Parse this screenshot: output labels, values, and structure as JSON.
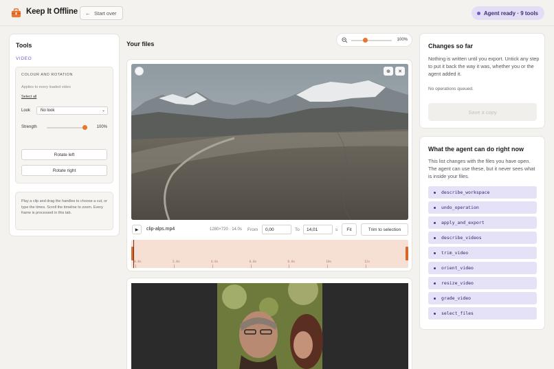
{
  "header": {
    "app_title": "Keep It Offline",
    "start_over_label": "Start over",
    "agent_status": "Agent ready · 9 tools",
    "accent_color": "#6a5ccf",
    "logo_icon": "briefcase-icon"
  },
  "tools_panel": {
    "title": "Tools",
    "active_tab": "VIDEO",
    "colour_section": {
      "title": "COLOUR AND ROTATION",
      "applies_text": "Applies to every loaded video",
      "select_all_label": "Select all",
      "look_label": "Look",
      "look_value": "No look",
      "strength_label": "Strength",
      "strength_value": "100%",
      "strength_level": 1.0,
      "rotate_left_label": "Rotate left",
      "rotate_right_label": "Rotate right"
    },
    "help_text": "Play a clip and drag the handles to choose a cut, or type the times. Scroll the timeline to zoom. Every frame is processed in this tab."
  },
  "files": {
    "title": "Your files",
    "zoom_value": "100%",
    "zoom_level": 0.35,
    "clip": {
      "name": "clip-alps.mp4",
      "meta": "1280×720 · 14.0s",
      "from_label": "From",
      "from_value": "0,00",
      "to_label": "To",
      "to_value": "14,01",
      "unit": "s",
      "fit_label": "Fit",
      "trim_label": "Trim to selection",
      "play_icon": "play-icon",
      "zoom_in_icon": "zoom-in-icon",
      "close_icon": "close-icon",
      "timeline_ticks": [
        "0.0s",
        "2.0s",
        "4.0s",
        "6.0s",
        "8.0s",
        "10s",
        "12s"
      ],
      "timeline_tick_values": [
        0,
        2,
        4,
        6,
        8,
        10,
        12
      ],
      "duration": 14.0,
      "timeline_color": "#f6dfd3",
      "handle_color": "#d9652a"
    }
  },
  "changes": {
    "title": "Changes so far",
    "description": "Nothing is written until you export. Untick any step to put it back the way it was, whether you or the agent added it.",
    "no_ops": "No operations queued.",
    "save_label": "Save a copy"
  },
  "agent_tools": {
    "title": "What the agent can do right now",
    "description": "This list changes with the files you have open. The agent can use these, but it never sees what is inside your files.",
    "items": [
      "describe_workspace",
      "undo_operation",
      "apply_and_export",
      "describe_videos",
      "trim_video",
      "orient_video",
      "resize_video",
      "grade_video",
      "select_files"
    ]
  }
}
